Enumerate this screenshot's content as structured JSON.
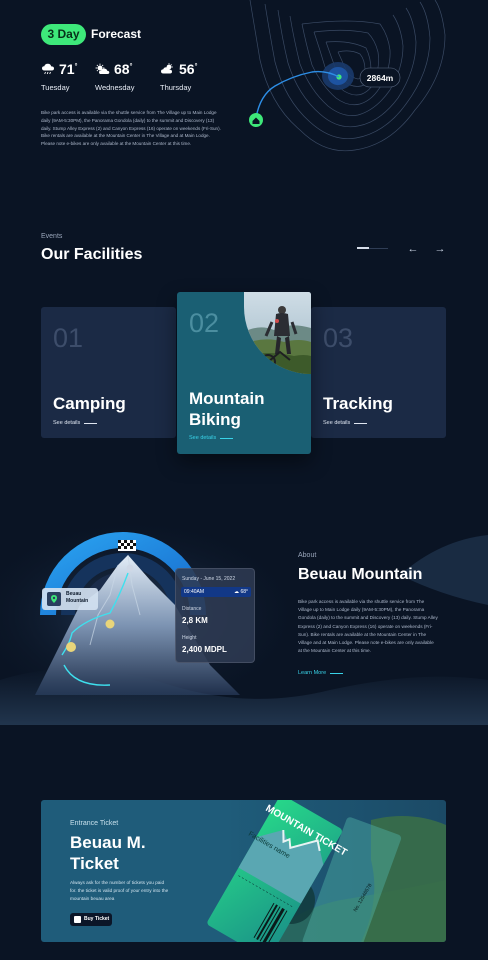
{
  "forecast": {
    "badge": "3 Day",
    "title": "Forecast",
    "days": [
      {
        "temp": "71",
        "deg": "°",
        "day": "Tuesday",
        "icon": "rain-cloud-icon"
      },
      {
        "temp": "68",
        "deg": "°",
        "day": "Wednesday",
        "icon": "partly-sunny-icon"
      },
      {
        "temp": "56",
        "deg": "°",
        "day": "Thursday",
        "icon": "cloudy-sun-icon"
      }
    ],
    "text": "Bike park access is available via the shuttle service from The Village up to Main Lodge daily (9AM-5:30PM), the Panorama Gondola (daily) to the summit and Discovery (13) daily. Stump Alley Express (2) and Canyon Express (16) operate on weekends (Fri-Sun). Bike rentals are available at the Mountain Center in The Village and at Main Lodge. Please note e-bikes are only available at the Mountain Center at this time.",
    "elevation": "2864m"
  },
  "facilities": {
    "label": "Events",
    "title": "Our Facilities",
    "cards": [
      {
        "num": "01",
        "name": "Camping",
        "link": "See details"
      },
      {
        "num": "02",
        "name": "Mountain Biking",
        "link": "See details"
      },
      {
        "num": "03",
        "name": "Tracking",
        "link": "See details"
      }
    ],
    "slider_progress": 0.38
  },
  "about": {
    "label": "About",
    "title": "Beuau Mountain",
    "text": "Bike park access is available via the shuttle service from The Village up to Main Lodge daily (9AM-5:30PM), the Panorama Gondola (daily) to the summit and Discovery (13) daily. Stump Alley Express (2) and Canyon Express (16) operate on weekends (Fri-Sun). Bike rentals are available at the Mountain Center in The Village and at Main Lodge. Please note e-bikes are only available at the Mountain Center at this time.",
    "link": "Learn More",
    "location_name": "Beuau Mountain",
    "info": {
      "date": "Sunday - June 15, 2022",
      "time": "09:40AM",
      "weather_temp": "68",
      "deg": "°",
      "distance_label": "Distance",
      "distance": "2,8 KM",
      "height_label": "Height",
      "height": "2,400 MDPL"
    }
  },
  "ticket": {
    "label": "Entrance Ticket",
    "title": "Beuau M. Ticket",
    "text": "Always ask for the number of tickets you paid for. the ticket is valid proof of your entry into the mountain beuau area",
    "button": "Buy Ticket",
    "stub_title": "MOUNTAIN TICKET",
    "stub_sub": "Facilities name",
    "serial": "No. 12546578"
  },
  "colors": {
    "background": "#0a1424",
    "accent_green": "#3ee87a",
    "accent_cyan": "#39d3e8",
    "card": "#1b2a45",
    "card_active": "#1a5f73"
  }
}
